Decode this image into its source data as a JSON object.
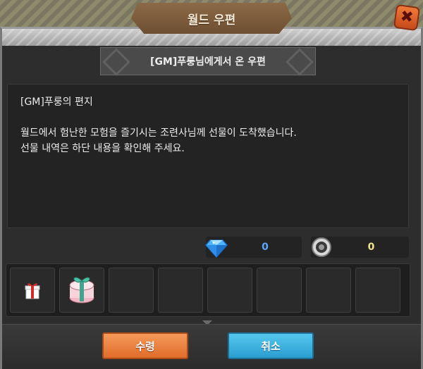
{
  "window": {
    "title": "월드 우편",
    "close_icon": "close-x-icon"
  },
  "mail": {
    "subject": "[GM]푸룽님에게서 온 우편",
    "letter_title": "[GM]푸룽의 편지",
    "body_lines": [
      "월드에서 험난한 모험을 즐기시는 조련사님께 선물이 도착했습니다.",
      "선물 내역은 하단 내용을 확인해 주세요."
    ]
  },
  "currency": {
    "gem": {
      "icon": "diamond-icon",
      "value": "0"
    },
    "coin": {
      "icon": "silver-coin-icon",
      "value": "0"
    }
  },
  "items": [
    {
      "icon": "gift-box-icon"
    },
    {
      "icon": "gift-cake-icon"
    },
    {
      "icon": ""
    },
    {
      "icon": ""
    },
    {
      "icon": ""
    },
    {
      "icon": ""
    },
    {
      "icon": ""
    },
    {
      "icon": ""
    }
  ],
  "buttons": {
    "accept_label": "수령",
    "cancel_label": "취소"
  },
  "colors": {
    "accept": "#e87a3a",
    "cancel": "#3ab2e0",
    "gem_value": "#5fa6ff",
    "coin_value": "#f0e48a"
  }
}
